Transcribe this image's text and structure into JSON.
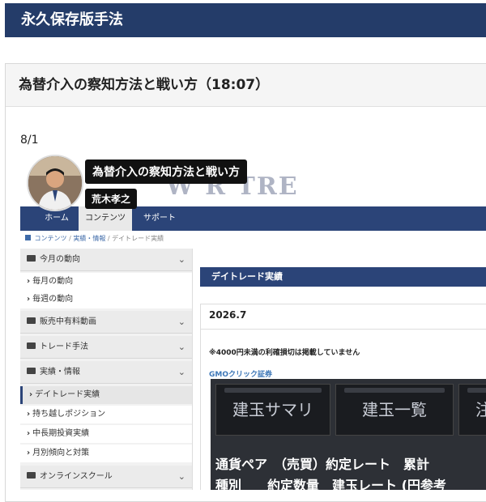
{
  "header": {
    "title": "永久保存版手法"
  },
  "panel": {
    "title": "為替介入の察知方法と戦い方（18:07）"
  },
  "post": {
    "date": "8/1"
  },
  "video": {
    "title": "為替介入の察知方法と戦い方",
    "author": "荒木孝之",
    "nav": [
      "ホーム",
      "コンテンツ",
      "サポート"
    ],
    "breadcrumb": [
      "コンテンツ",
      "/",
      "実績・情報",
      "/",
      "デイトレード実績"
    ],
    "sidebar": [
      {
        "label": "今月の動向",
        "type": "category"
      },
      {
        "label": "毎月の動向",
        "type": "sub"
      },
      {
        "label": "毎週の動向",
        "type": "sub"
      },
      {
        "label": "販売中有料動画",
        "type": "category"
      },
      {
        "label": "トレード手法",
        "type": "category"
      },
      {
        "label": "実績・情報",
        "type": "category"
      },
      {
        "label": "デイトレード実績",
        "type": "sub"
      },
      {
        "label": "持ち越しポジション",
        "type": "sub"
      },
      {
        "label": "中長期投資実績",
        "type": "sub"
      },
      {
        "label": "月別傾向と対策",
        "type": "sub"
      },
      {
        "label": "オンラインスクール",
        "type": "category"
      }
    ],
    "main": {
      "section_title": "デイトレード実績",
      "year": "2026.7",
      "note": "※4000円未満の利確損切は掲載していません",
      "broker": "GMOクリック証券",
      "tabs": [
        "建玉サマリ",
        "建玉一覧",
        "注"
      ],
      "table_line1": "通貨ペア　（売買）約定レート　累計",
      "table_line2": "種別　　約定数量　建玉レート (円参考"
    }
  },
  "colors": {
    "header_bg": "#243c69",
    "nav_bg": "#2b4478",
    "link": "#3e78b8"
  }
}
